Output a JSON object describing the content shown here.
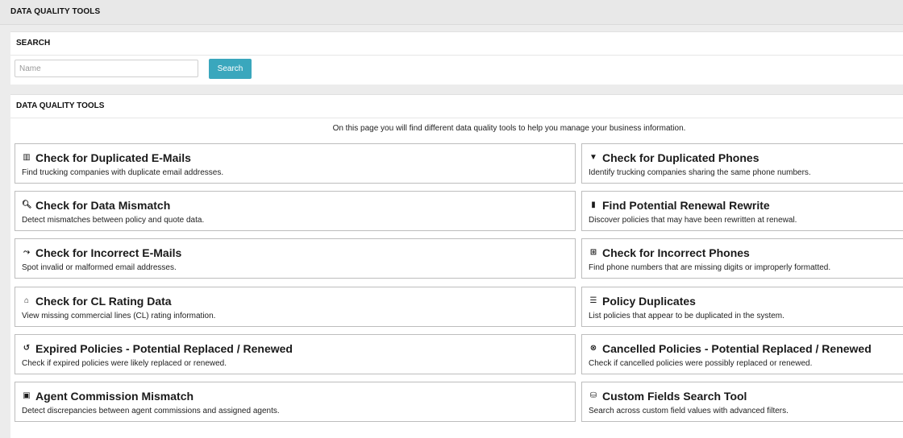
{
  "header": {
    "title": "DATA QUALITY TOOLS"
  },
  "search": {
    "section_title": "SEARCH",
    "placeholder": "Name",
    "button_label": "Search"
  },
  "tools_section": {
    "section_title": "DATA QUALITY TOOLS",
    "intro": "On this page you will find different data quality tools to help you manage your business information."
  },
  "tools": [
    {
      "icon": "columns-icon",
      "glyph": "▥",
      "title": "Check for Duplicated E-Mails",
      "desc": "Find trucking companies with duplicate email addresses."
    },
    {
      "icon": "filter-icon",
      "glyph": "▼",
      "title": "Check for Duplicated Phones",
      "desc": "Identify trucking companies sharing the same phone numbers."
    },
    {
      "icon": "zoom-icon",
      "glyph": "🔍︎",
      "title": "Check for Data Mismatch",
      "desc": "Detect mismatches between policy and quote data."
    },
    {
      "icon": "bar-chart-icon",
      "glyph": "▮",
      "title": "Find Potential Renewal Rewrite",
      "desc": "Discover policies that may have been rewritten at renewal."
    },
    {
      "icon": "line-chart-icon",
      "glyph": "⤳",
      "title": "Check for Incorrect E-Mails",
      "desc": "Spot invalid or malformed email addresses."
    },
    {
      "icon": "table-icon",
      "glyph": "⊞",
      "title": "Check for Incorrect Phones",
      "desc": "Find phone numbers that are missing digits or improperly formatted."
    },
    {
      "icon": "tag-icon",
      "glyph": "⌂",
      "title": "Check for CL Rating Data",
      "desc": "View missing commercial lines (CL) rating information."
    },
    {
      "icon": "list-icon",
      "glyph": "☰",
      "title": "Policy Duplicates",
      "desc": "List policies that appear to be duplicated in the system."
    },
    {
      "icon": "history-icon",
      "glyph": "↺",
      "title": "Expired Policies - Potential Replaced / Renewed",
      "desc": "Check if expired policies were likely replaced or renewed."
    },
    {
      "icon": "cancel-circle-icon",
      "glyph": "⊗",
      "title": "Cancelled Policies - Potential Replaced / Renewed",
      "desc": "Check if cancelled policies were possibly replaced or renewed."
    },
    {
      "icon": "money-icon",
      "glyph": "▣",
      "title": "Agent Commission Mismatch",
      "desc": "Detect discrepancies between agent commissions and assigned agents."
    },
    {
      "icon": "search-db-icon",
      "glyph": "⛁",
      "title": "Custom Fields Search Tool",
      "desc": "Search across custom field values with advanced filters."
    }
  ]
}
